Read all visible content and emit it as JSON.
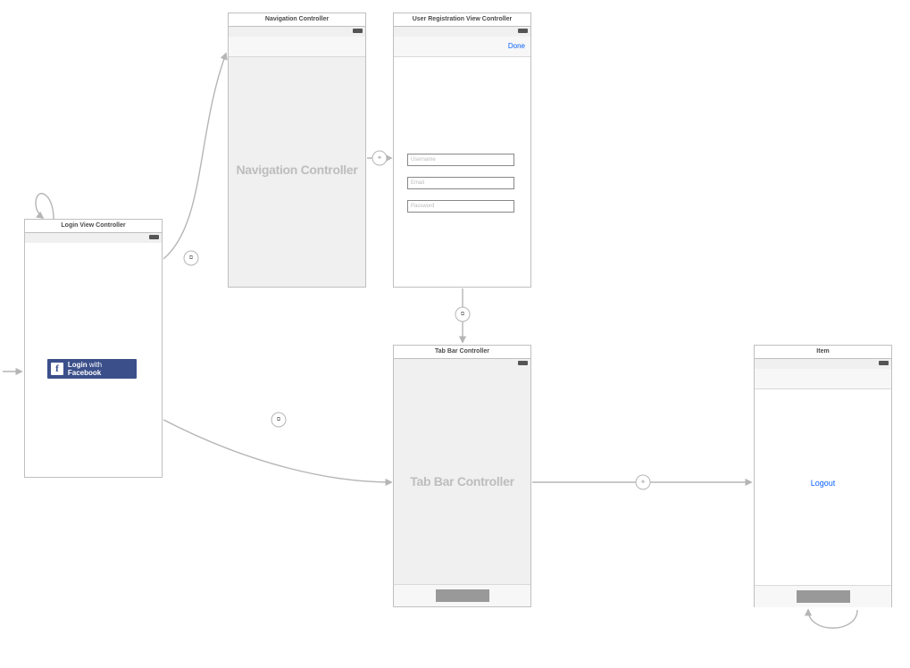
{
  "scenes": {
    "login": {
      "title": "Login View Controller",
      "fb_button_prefix": "Login ",
      "fb_button_mid": "with ",
      "fb_button_brand": "Facebook"
    },
    "nav": {
      "title": "Navigation Controller",
      "placeholder_label": "Navigation Controller"
    },
    "register": {
      "title": "User Registration View Controller",
      "done_label": "Done",
      "username_ph": "Username",
      "email_ph": "Email",
      "password_ph": "Password"
    },
    "tabbar": {
      "title": "Tab Bar Controller",
      "placeholder_label": "Tab Bar Controller"
    },
    "item": {
      "title": "Item",
      "logout_label": "Logout"
    }
  },
  "segue_glyph": "⧉",
  "relationship_glyph": "⟡"
}
